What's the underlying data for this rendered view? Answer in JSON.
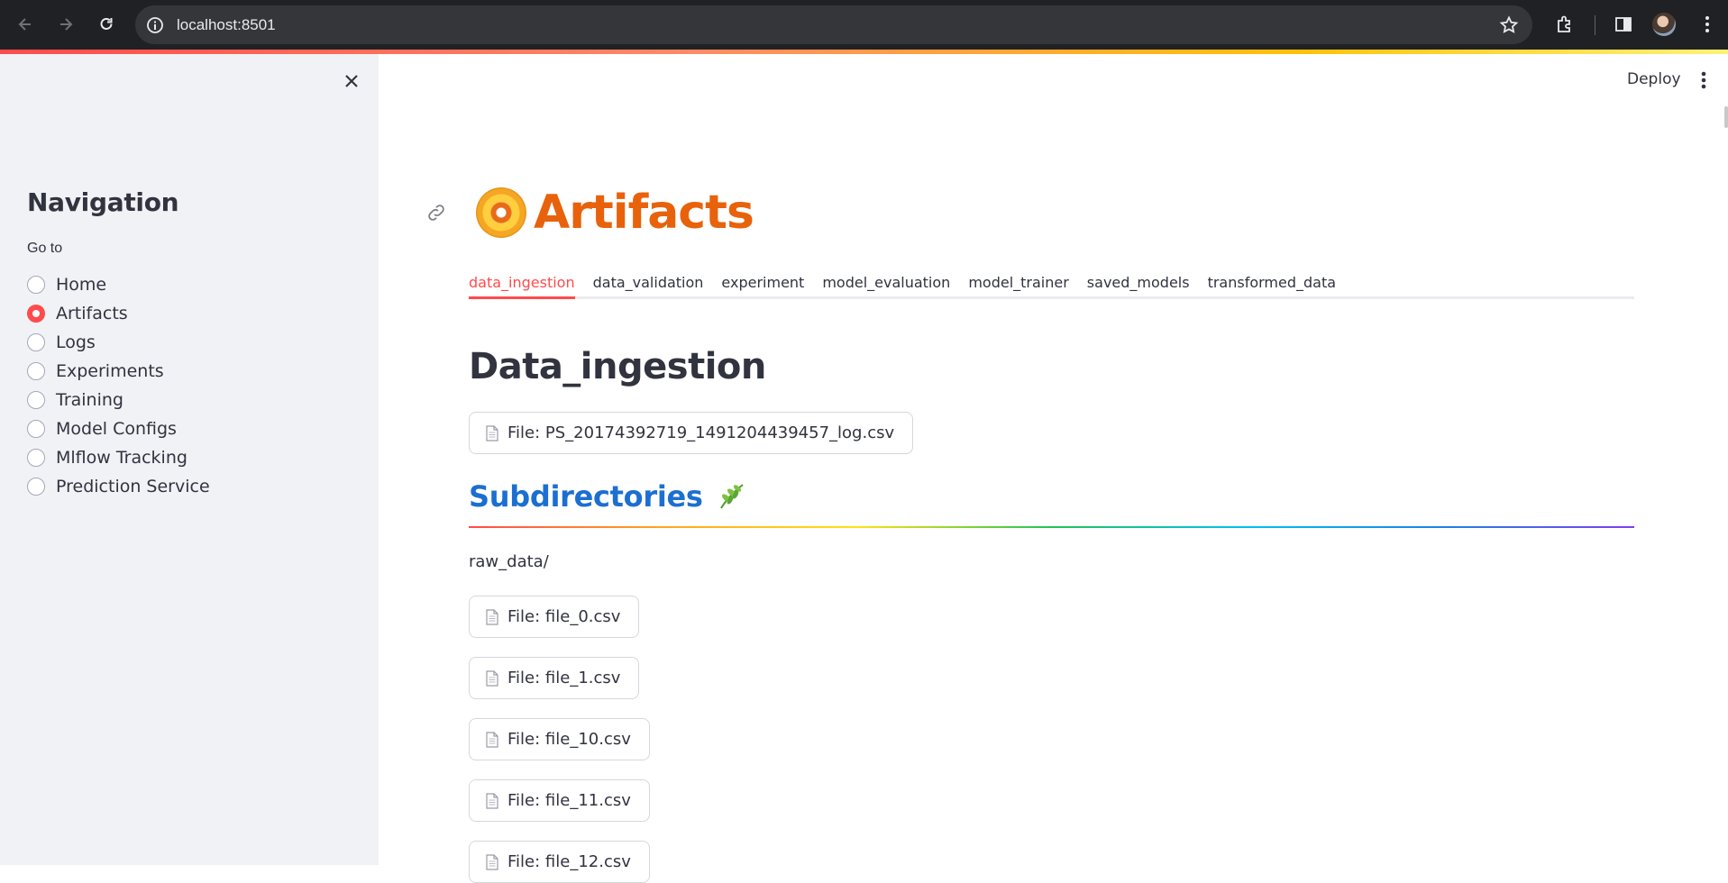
{
  "browser": {
    "url": "localhost:8501"
  },
  "sidebar": {
    "heading": "Navigation",
    "goto_label": "Go to",
    "items": [
      {
        "label": "Home",
        "selected": false
      },
      {
        "label": "Artifacts",
        "selected": true
      },
      {
        "label": "Logs",
        "selected": false
      },
      {
        "label": "Experiments",
        "selected": false
      },
      {
        "label": "Training",
        "selected": false
      },
      {
        "label": "Model Configs",
        "selected": false
      },
      {
        "label": "Mlflow Tracking",
        "selected": false
      },
      {
        "label": "Prediction Service",
        "selected": false
      }
    ]
  },
  "header": {
    "deploy_label": "Deploy"
  },
  "main": {
    "title": "Artifacts",
    "tabs": [
      "data_ingestion",
      "data_validation",
      "experiment",
      "model_evaluation",
      "model_trainer",
      "saved_models",
      "transformed_data"
    ],
    "active_tab": "data_ingestion",
    "section_title": "Data_ingestion",
    "top_file": "File: PS_20174392719_1491204439457_log.csv",
    "subdirectories_title": "Subdirectories",
    "raw_data_label": "raw_data/",
    "raw_files": [
      "File: file_0.csv",
      "File: file_1.csv",
      "File: file_10.csv",
      "File: file_11.csv",
      "File: file_12.csv"
    ]
  },
  "colors": {
    "accent": "#ff4b4b",
    "title": "#e8620c",
    "subdir": "#1c6fd1"
  }
}
